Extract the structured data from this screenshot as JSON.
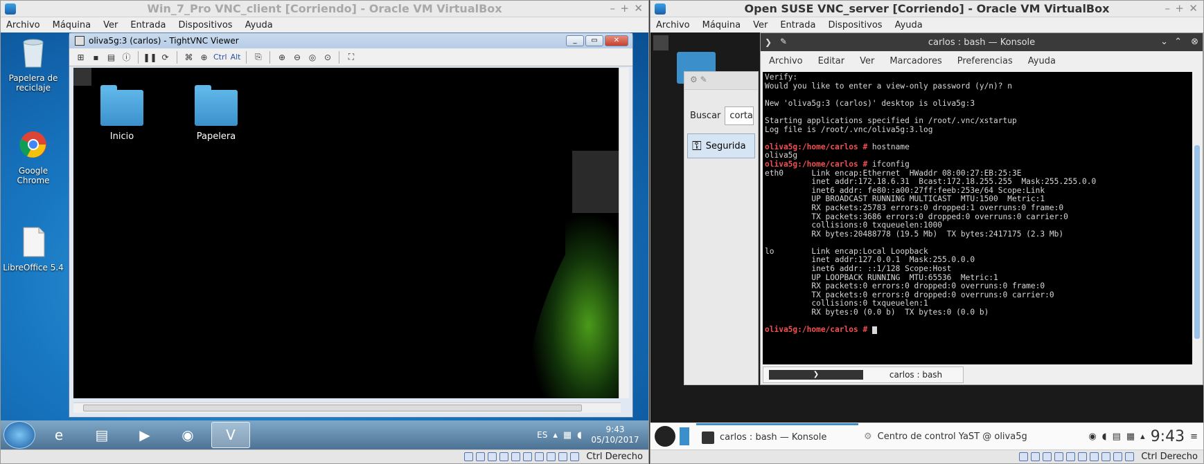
{
  "left_vm": {
    "title": "Win_7_Pro VNC_client [Corriendo] - Oracle VM VirtualBox",
    "menu": [
      "Archivo",
      "Máquina",
      "Ver",
      "Entrada",
      "Dispositivos",
      "Ayuda"
    ],
    "host_key": "Ctrl Derecho",
    "desktop_icons": [
      {
        "label": "Papelera de reciclaje"
      },
      {
        "label": "Google Chrome"
      },
      {
        "label": "LibreOffice 5.4"
      }
    ],
    "tightvnc": {
      "title": "oliva5g:3 (carlos) - TightVNC Viewer",
      "toolbar_ctrl": "Ctrl",
      "toolbar_alt": "Alt",
      "remote_icons": [
        {
          "label": "Inicio"
        },
        {
          "label": "Papelera"
        }
      ]
    },
    "taskbar": {
      "language": "ES",
      "time": "9:43",
      "date": "05/10/2017"
    }
  },
  "right_vm": {
    "title": "Open SUSE VNC_server [Corriendo] - Oracle VM VirtualBox",
    "menu": [
      "Archivo",
      "Máquina",
      "Ver",
      "Entrada",
      "Dispositivos",
      "Ayuda"
    ],
    "host_key": "Ctrl Derecho",
    "yast": {
      "search_label": "Buscar",
      "search_value": "corta",
      "item_label": "Segurida"
    },
    "konsole": {
      "title": "carlos : bash — Konsole",
      "menu": [
        "Archivo",
        "Editar",
        "Ver",
        "Marcadores",
        "Preferencias",
        "Ayuda"
      ],
      "tab_label": "carlos : bash",
      "lines": [
        {
          "t": "Verify:"
        },
        {
          "t": "Would you like to enter a view-only password (y/n)? n"
        },
        {
          "t": ""
        },
        {
          "t": "New 'oliva5g:3 (carlos)' desktop is oliva5g:3"
        },
        {
          "t": ""
        },
        {
          "t": "Starting applications specified in /root/.vnc/xstartup"
        },
        {
          "t": "Log file is /root/.vnc/oliva5g:3.log"
        },
        {
          "t": ""
        },
        {
          "p": "oliva5g:/home/carlos # ",
          "t": "hostname"
        },
        {
          "t": "oliva5g"
        },
        {
          "p": "oliva5g:/home/carlos # ",
          "t": "ifconfig"
        },
        {
          "t": "eth0      Link encap:Ethernet  HWaddr 08:00:27:EB:25:3E"
        },
        {
          "t": "          inet addr:172.18.6.31  Bcast:172.18.255.255  Mask:255.255.0.0"
        },
        {
          "t": "          inet6 addr: fe80::a00:27ff:feeb:253e/64 Scope:Link"
        },
        {
          "t": "          UP BROADCAST RUNNING MULTICAST  MTU:1500  Metric:1"
        },
        {
          "t": "          RX packets:25783 errors:0 dropped:1 overruns:0 frame:0"
        },
        {
          "t": "          TX packets:3686 errors:0 dropped:0 overruns:0 carrier:0"
        },
        {
          "t": "          collisions:0 txqueuelen:1000"
        },
        {
          "t": "          RX bytes:20488778 (19.5 Mb)  TX bytes:2417175 (2.3 Mb)"
        },
        {
          "t": ""
        },
        {
          "t": "lo        Link encap:Local Loopback"
        },
        {
          "t": "          inet addr:127.0.0.1  Mask:255.0.0.0"
        },
        {
          "t": "          inet6 addr: ::1/128 Scope:Host"
        },
        {
          "t": "          UP LOOPBACK RUNNING  MTU:65536  Metric:1"
        },
        {
          "t": "          RX packets:0 errors:0 dropped:0 overruns:0 frame:0"
        },
        {
          "t": "          TX packets:0 errors:0 dropped:0 overruns:0 carrier:0"
        },
        {
          "t": "          collisions:0 txqueuelen:1"
        },
        {
          "t": "          RX bytes:0 (0.0 b)  TX bytes:0 (0.0 b)"
        },
        {
          "t": ""
        },
        {
          "p": "oliva5g:/home/carlos # ",
          "t": "",
          "cursor": true
        }
      ]
    },
    "panel": {
      "task1": "carlos : bash — Konsole",
      "task2": "Centro de control YaST @ oliva5g",
      "time": "9:43"
    }
  }
}
